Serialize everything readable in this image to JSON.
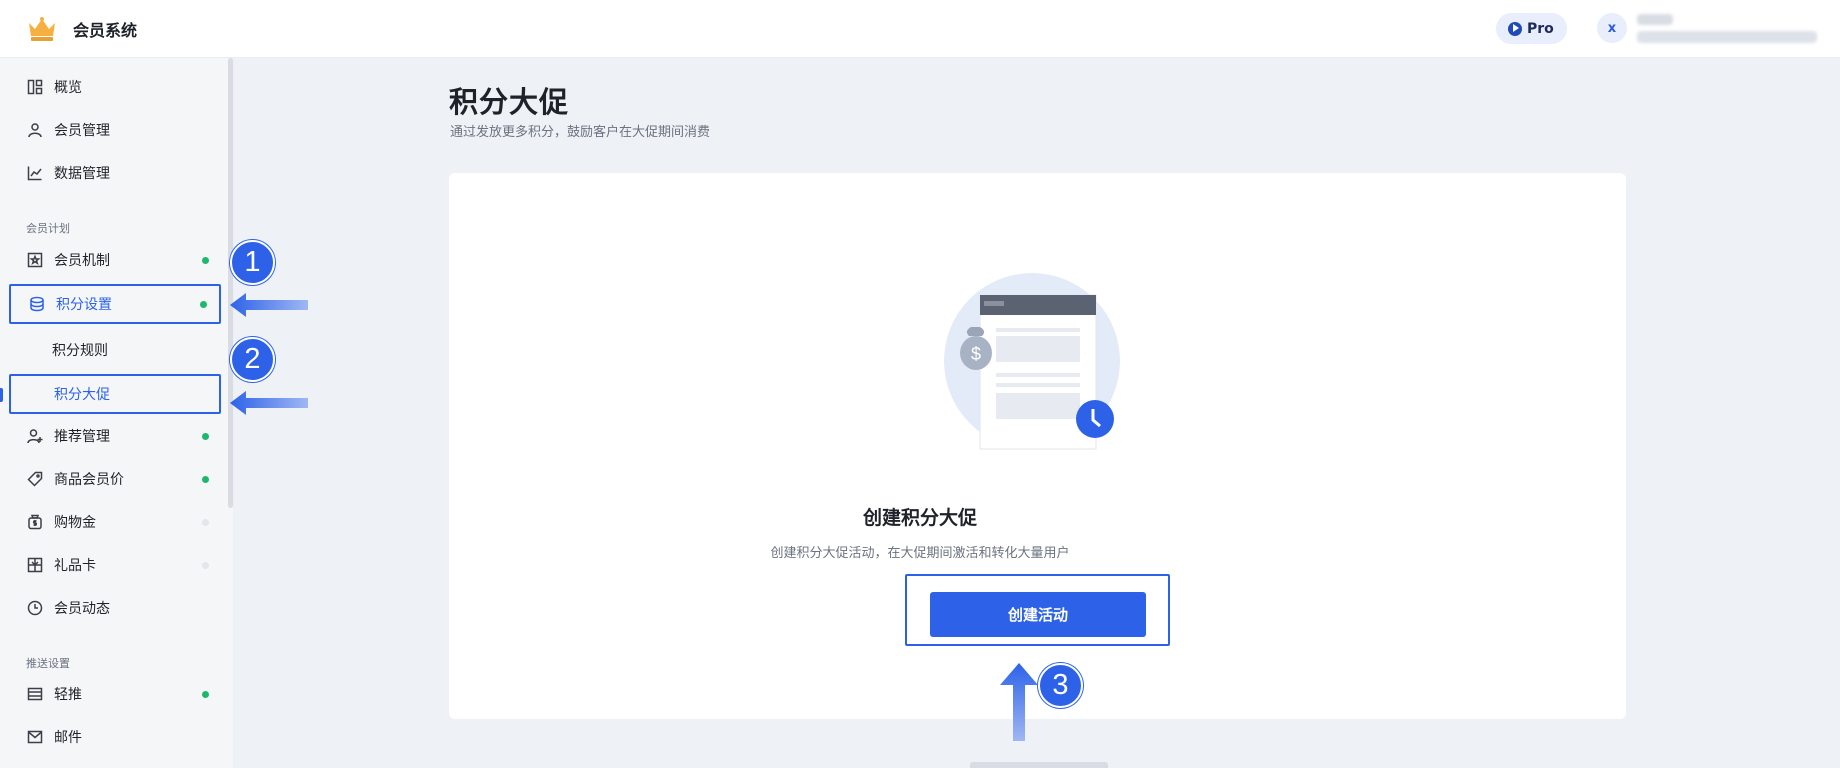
{
  "app": {
    "title": "会员系统",
    "plan_badge": "Pro",
    "avatar_initial": "x"
  },
  "sidebar": {
    "items": [
      {
        "label": "概览",
        "icon": "dashboard-icon",
        "dot": null
      },
      {
        "label": "会员管理",
        "icon": "user-icon",
        "dot": null
      },
      {
        "label": "数据管理",
        "icon": "chart-line-icon",
        "dot": null
      }
    ],
    "section_membership": "会员计划",
    "membership_items": [
      {
        "label": "会员机制",
        "icon": "member-card-icon",
        "dot": "green"
      },
      {
        "label": "积分设置",
        "icon": "coins-icon",
        "dot": "green",
        "active": true
      },
      {
        "label": "积分规则",
        "sub": true
      },
      {
        "label": "积分大促",
        "sub": true,
        "active": true
      },
      {
        "label": "推荐管理",
        "icon": "user-add-icon",
        "dot": "green"
      },
      {
        "label": "商品会员价",
        "icon": "tag-icon",
        "dot": "green"
      },
      {
        "label": "购物金",
        "icon": "money-bag-icon",
        "dot": "grey"
      },
      {
        "label": "礼品卡",
        "icon": "gift-card-icon",
        "dot": "grey"
      },
      {
        "label": "会员动态",
        "icon": "clock-icon",
        "dot": null
      }
    ],
    "section_push": "推送设置",
    "push_items": [
      {
        "label": "轻推",
        "icon": "window-icon",
        "dot": "green"
      },
      {
        "label": "邮件",
        "icon": "mail-icon",
        "dot": null
      }
    ]
  },
  "main": {
    "title": "积分大促",
    "description": "通过发放更多积分，鼓励客户在大促期间消费",
    "empty_state": {
      "title": "创建积分大促",
      "description": "创建积分大促活动，在大促期间激活和转化大量用户",
      "button": "创建活动"
    }
  },
  "annotations": {
    "step1": "1",
    "step2": "2",
    "step3": "3"
  },
  "colors": {
    "accent": "#2d62e8",
    "status_green": "#1db86a",
    "background": "#eef1f5"
  }
}
